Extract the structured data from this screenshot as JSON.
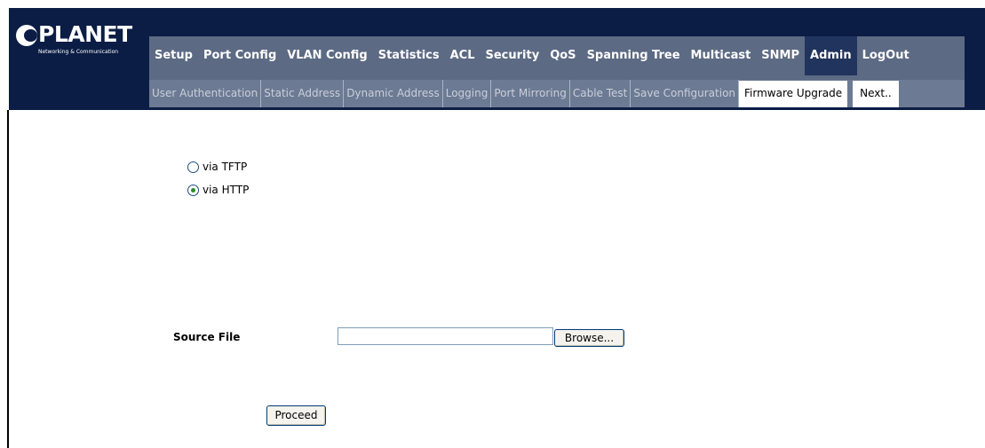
{
  "brand": {
    "name": "PLANET",
    "tagline": "Networking & Communication"
  },
  "main_menu": [
    {
      "label": "Setup",
      "active": false
    },
    {
      "label": "Port Config",
      "active": false
    },
    {
      "label": "VLAN Config",
      "active": false
    },
    {
      "label": "Statistics",
      "active": false
    },
    {
      "label": "ACL",
      "active": false
    },
    {
      "label": "Security",
      "active": false
    },
    {
      "label": "QoS",
      "active": false
    },
    {
      "label": "Spanning Tree",
      "active": false
    },
    {
      "label": "Multicast",
      "active": false
    },
    {
      "label": "SNMP",
      "active": false
    },
    {
      "label": "Admin",
      "active": true
    },
    {
      "label": "LogOut",
      "active": false
    }
  ],
  "sub_menu": [
    {
      "label": "User Authentication",
      "active": false
    },
    {
      "label": "Static Address",
      "active": false
    },
    {
      "label": "Dynamic Address",
      "active": false
    },
    {
      "label": "Logging",
      "active": false
    },
    {
      "label": "Port Mirroring",
      "active": false
    },
    {
      "label": "Cable Test",
      "active": false
    },
    {
      "label": "Save Configuration",
      "active": false
    },
    {
      "label": "Firmware Upgrade",
      "active": true
    },
    {
      "label": "Next..",
      "active": false
    }
  ],
  "upgrade_method": {
    "options": [
      {
        "label": "via TFTP",
        "checked": false
      },
      {
        "label": "via HTTP",
        "checked": true
      }
    ]
  },
  "source_file": {
    "label": "Source File",
    "value": "",
    "browse_label": "Browse..."
  },
  "proceed_label": "Proceed",
  "colors": {
    "header_bg": "#0b1d45",
    "menu_bg": "#5c6a84",
    "menu_active_bg": "#21345d",
    "submenu_bg": "#6c7a93",
    "submenu_text": "#c9cfdb"
  }
}
